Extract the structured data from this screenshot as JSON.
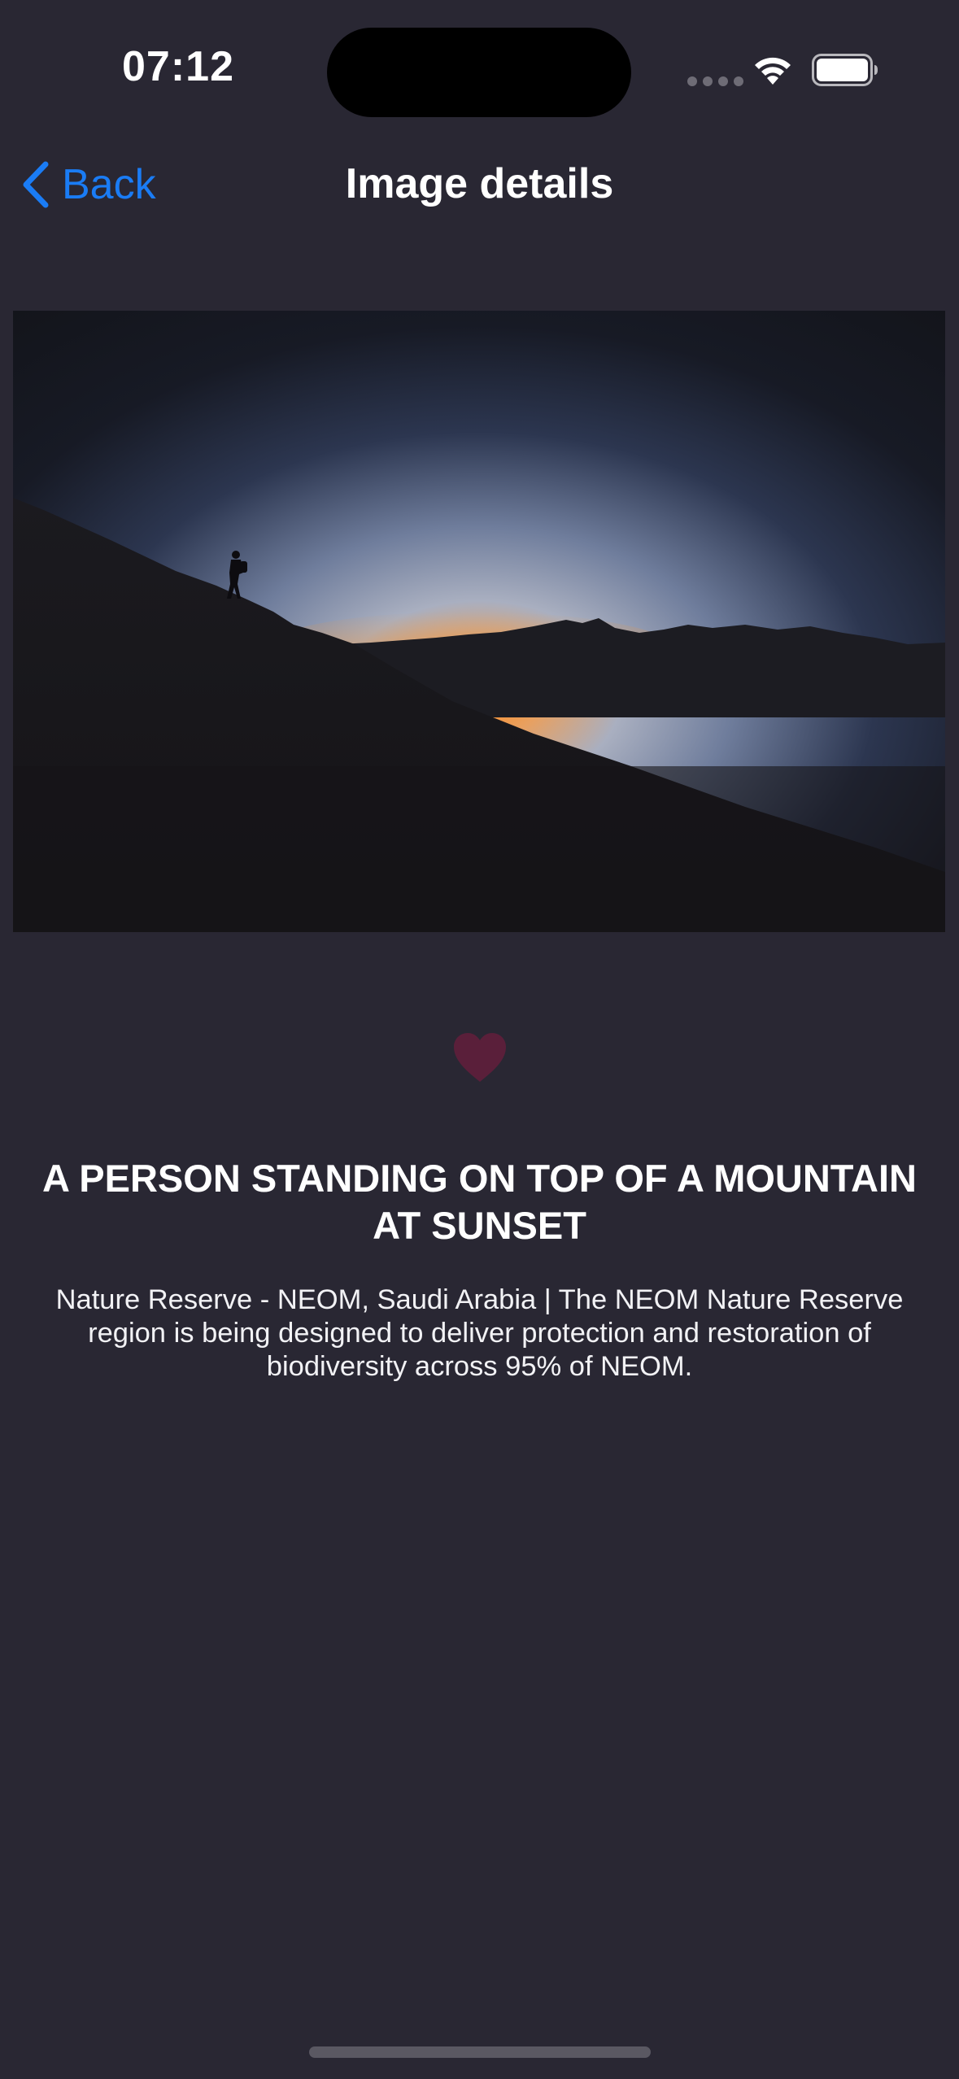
{
  "status_bar": {
    "time": "07:12"
  },
  "nav": {
    "back_label": "Back",
    "title": "Image details"
  },
  "photo": {
    "icon": "photo-mountain-sunset"
  },
  "favorite": {
    "icon": "heart-icon",
    "color": "#5a1f3a"
  },
  "details": {
    "title": "A PERSON STANDING ON TOP OF A MOUNTAIN AT SUNSET",
    "description": "Nature Reserve - NEOM, Saudi Arabia | The NEOM Nature Reserve region is being designed to deliver protection and restoration of biodiversity across 95% of NEOM."
  },
  "colors": {
    "background": "#292733",
    "accent": "#1a7cf5"
  }
}
